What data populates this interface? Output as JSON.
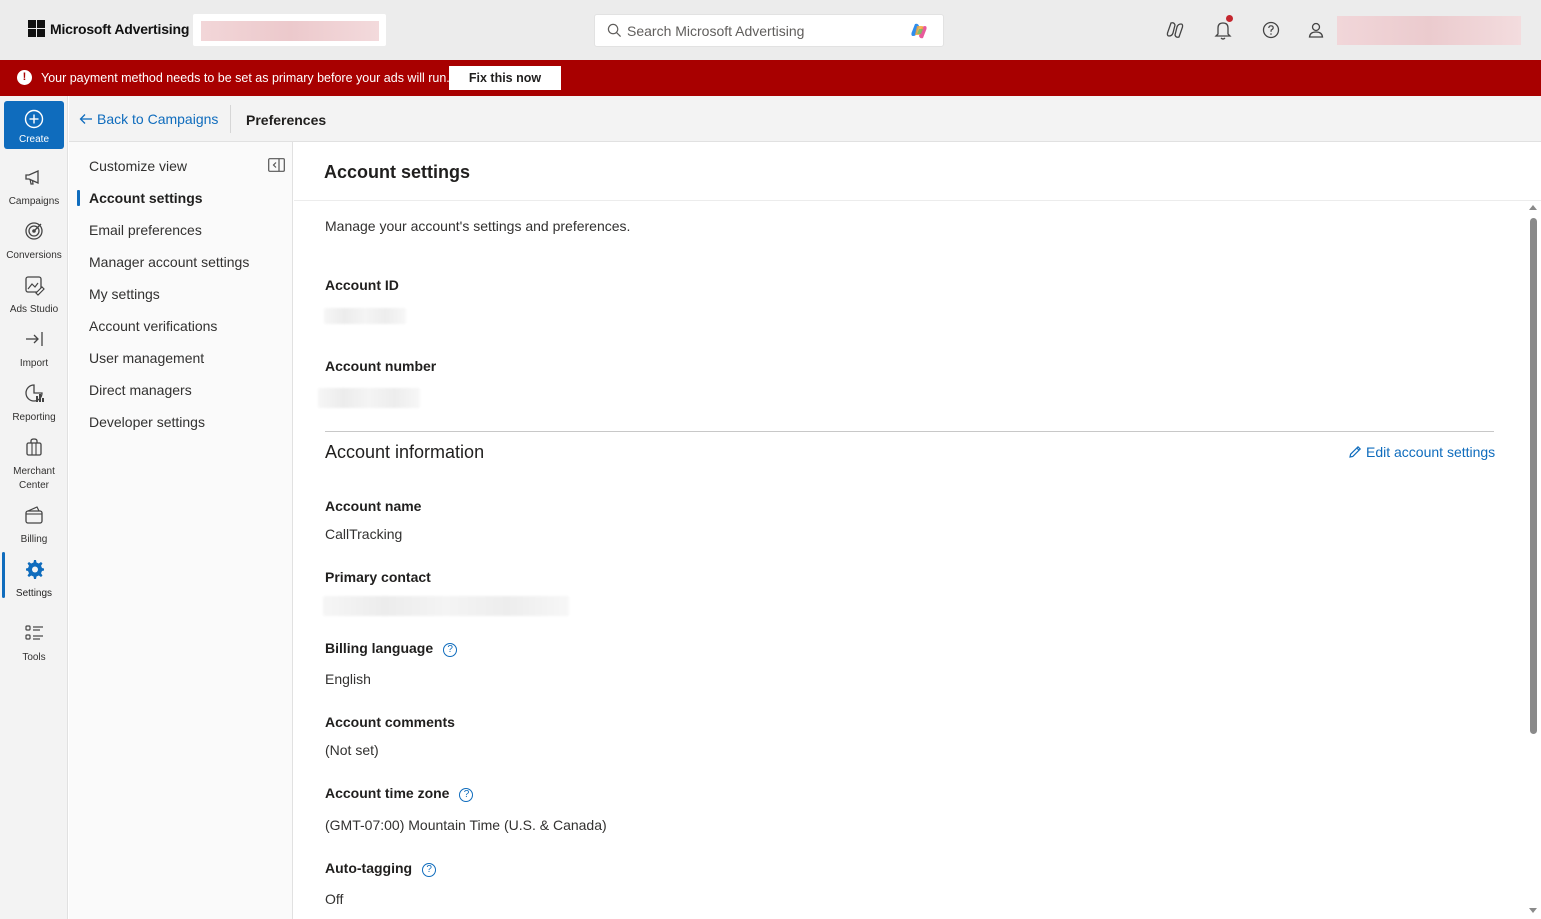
{
  "app": {
    "brand": "Microsoft Advertising"
  },
  "search": {
    "placeholder": "Search Microsoft Advertising"
  },
  "alert": {
    "message": "Your payment method needs to be set as primary before your ads will run.",
    "action_label": "Fix this now",
    "color": "#a80000"
  },
  "rail": {
    "create_label": "Create",
    "items": [
      {
        "label": "Campaigns",
        "icon": "megaphone-icon"
      },
      {
        "label": "Conversions",
        "icon": "target-icon"
      },
      {
        "label": "Ads Studio",
        "icon": "ads-studio-icon"
      },
      {
        "label": "Import",
        "icon": "import-icon"
      },
      {
        "label": "Reporting",
        "icon": "reporting-icon"
      },
      {
        "label": "Merchant Center",
        "label_line1": "Merchant",
        "label_line2": "Center",
        "icon": "shopping-bag-icon"
      },
      {
        "label": "Billing",
        "icon": "wallet-icon"
      },
      {
        "label": "Settings",
        "icon": "gear-icon",
        "active": true
      },
      {
        "label": "Tools",
        "icon": "tools-icon"
      }
    ]
  },
  "header": {
    "back_label": "Back to Campaigns",
    "breadcrumb": "Preferences"
  },
  "subnav": {
    "items": [
      {
        "label": "Customize view"
      },
      {
        "label": "Account settings",
        "active": true
      },
      {
        "label": "Email preferences"
      },
      {
        "label": "Manager account settings"
      },
      {
        "label": "My settings"
      },
      {
        "label": "Account verifications"
      },
      {
        "label": "User management"
      },
      {
        "label": "Direct managers"
      },
      {
        "label": "Developer settings"
      }
    ]
  },
  "main": {
    "title": "Account settings",
    "description": "Manage your account's settings and preferences.",
    "account_id_label": "Account ID",
    "account_number_label": "Account number",
    "section_title": "Account information",
    "edit_label": "Edit account settings",
    "fields": {
      "account_name": {
        "label": "Account name",
        "value": "CallTracking"
      },
      "primary_contact": {
        "label": "Primary contact"
      },
      "billing_language": {
        "label": "Billing language",
        "value": "English"
      },
      "account_comments": {
        "label": "Account comments",
        "value": "(Not set)"
      },
      "time_zone": {
        "label": "Account time zone",
        "value": "(GMT-07:00) Mountain Time (U.S. & Canada)"
      },
      "auto_tagging": {
        "label": "Auto-tagging",
        "value": "Off"
      }
    }
  },
  "colors": {
    "accent": "#0f6cbd",
    "rail_bg": "#f3f3f3",
    "topbar_bg": "#ececec"
  }
}
